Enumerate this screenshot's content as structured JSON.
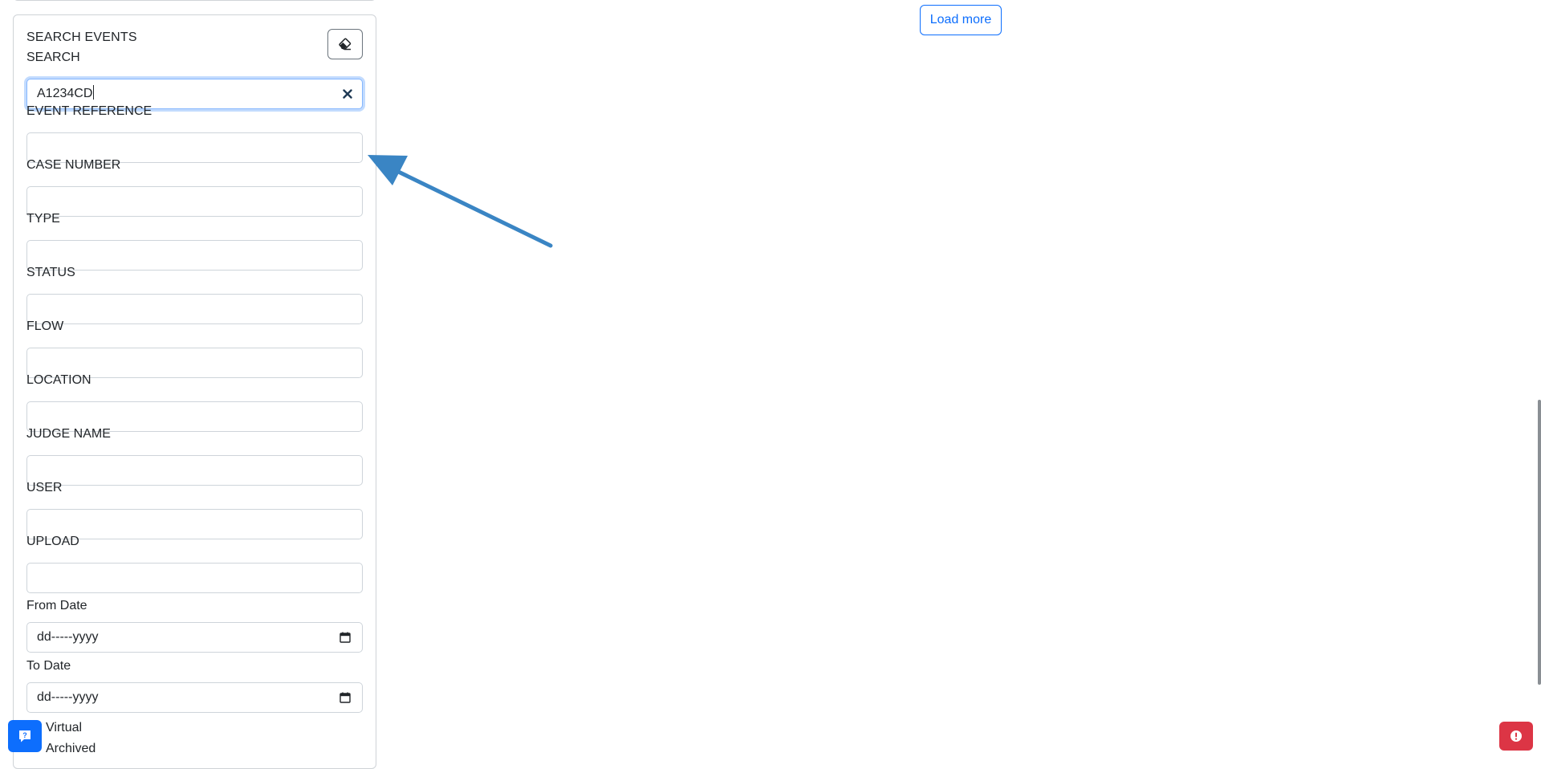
{
  "filter_panel": {
    "title": "SEARCH EVENTS",
    "clear_icon": "eraser-icon",
    "search": {
      "label": "SEARCH",
      "value": "A1234CD",
      "clear_icon": "close-icon"
    },
    "fields": [
      {
        "label": "EVENT REFERENCE",
        "value": ""
      },
      {
        "label": "CASE NUMBER",
        "value": ""
      },
      {
        "label": "TYPE",
        "value": ""
      },
      {
        "label": "STATUS",
        "value": ""
      },
      {
        "label": "FLOW",
        "value": ""
      },
      {
        "label": "LOCATION",
        "value": ""
      },
      {
        "label": "JUDGE NAME",
        "value": ""
      },
      {
        "label": "USER",
        "value": ""
      },
      {
        "label": "UPLOAD",
        "value": ""
      }
    ],
    "from_date": {
      "label": "From Date",
      "value": "dd-----yyyy",
      "icon": "calendar-icon"
    },
    "to_date": {
      "label": "To Date",
      "value": "dd-----yyyy",
      "icon": "calendar-icon"
    },
    "checkboxes": [
      {
        "label": "Virtual"
      },
      {
        "label": "Archived"
      }
    ]
  },
  "results": {
    "load_more_label": "Load more"
  },
  "annotation": {
    "arrow_color": "#3a85c4"
  },
  "floating": {
    "chat_icon": "question-chat-icon",
    "alert_icon": "alert-icon"
  },
  "colors": {
    "primary": "#0d6efd",
    "danger": "#dc3545",
    "focus_border": "#86b7fe"
  }
}
